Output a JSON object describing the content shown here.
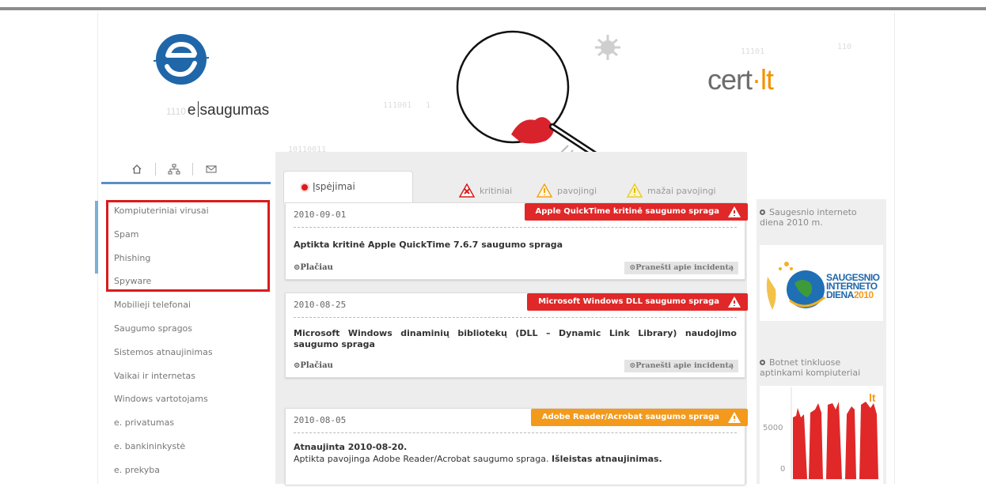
{
  "brand": {
    "left_logo_binary": "1110",
    "left_logo_word_a": "e",
    "left_logo_word_b": "saugumas",
    "right_logo_a": "cert",
    "right_logo_dot": "·",
    "right_logo_b": "lt"
  },
  "nav_icons": [
    "home-icon",
    "sitemap-icon",
    "mail-icon"
  ],
  "sidebar": {
    "items": [
      "Kompiuteriniai virusai",
      "Spam",
      "Phishing",
      "Spyware",
      "Mobilieji telefonai",
      "Saugumo spragos",
      "Sistemos atnaujinimas",
      "Vaikai ir internetas",
      "Windows vartotojams",
      "e. privatumas",
      "e. bankininkystė",
      "e. prekyba"
    ],
    "highlight_color": "#d91c1c"
  },
  "tabs": {
    "active": "Įspėjimai",
    "legend": [
      "kritiniai",
      "pavojingi",
      "mažai pavojingi"
    ]
  },
  "alerts": [
    {
      "date": "2010-09-01",
      "banner": "Apple QuickTime kritinė saugumo spraga",
      "banner_color": "#e02828",
      "title": "Aptikta kritinė Apple QuickTime 7.6.7 saugumo spraga",
      "more": "Plačiau",
      "report": "Pranešti apie incidentą"
    },
    {
      "date": "2010-08-25",
      "banner": "Microsoft Windows DLL saugumo spraga",
      "banner_color": "#e02828",
      "title": "Microsoft Windows dinaminių bibliotekų (DLL – Dynamic Link Library) naudojimo saugumo spraga",
      "more": "Plačiau",
      "report": "Pranešti apie incidentą"
    },
    {
      "date": "2010-08-05",
      "banner": "Adobe Reader/Acrobat saugumo spraga",
      "banner_color": "#f39a1c",
      "title": "Atnaujinta 2010-08-20.",
      "body_a": "Aptikta pavojinga Adobe Reader/Acrobat saugumo spraga.",
      "body_b": "Išleistas atnaujinimas."
    }
  ],
  "right": {
    "box1": "Saugesnio interneto diena 2010 m.",
    "promo_line1": "SAUGESNIO",
    "promo_line2": "INTERNETO",
    "promo_line3": "DIENA",
    "promo_year": "2010",
    "box2": "Botnet tinkluose aptinkami kompiuteriai",
    "chart_tick_top": "5000",
    "chart_tick_bottom": "0",
    "chart_logo": "lt"
  }
}
